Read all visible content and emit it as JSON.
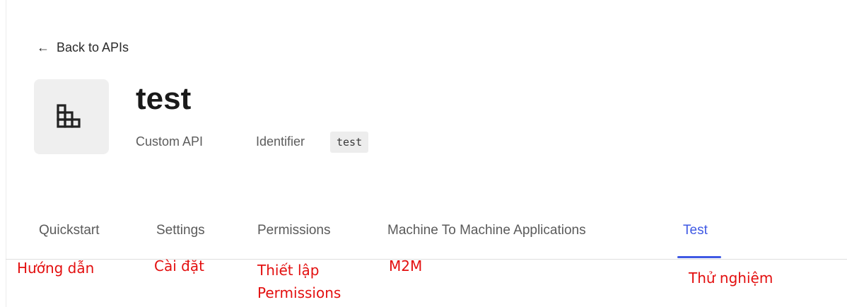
{
  "back_link": {
    "arrow": "←",
    "label": "Back to APIs"
  },
  "api": {
    "icon": "grid-blocks-icon",
    "name": "test",
    "type": "Custom API",
    "identifier_label": "Identifier",
    "identifier_value": "test"
  },
  "tabs": [
    {
      "label": "Quickstart",
      "active": false
    },
    {
      "label": "Settings",
      "active": false
    },
    {
      "label": "Permissions",
      "active": false
    },
    {
      "label": "Machine To Machine Applications",
      "active": false
    },
    {
      "label": "Test",
      "active": true
    }
  ],
  "annotations": {
    "quickstart": "Hướng dẫn",
    "settings": "Cài đặt",
    "permissions_line1": "Thiết lập",
    "permissions_line2": "Permissions",
    "m2m": "M2M",
    "test": "Thử nghiệm"
  },
  "colors": {
    "accent": "#3f59e4",
    "annotation": "#e30f0f"
  }
}
